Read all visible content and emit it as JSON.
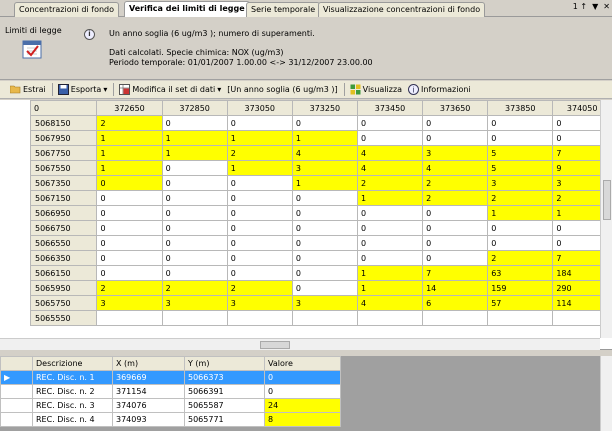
{
  "tabs": [
    {
      "label": "Concentrazioni di fondo"
    },
    {
      "label": "Verifica dei limiti di legge"
    },
    {
      "label": "Serie temporale"
    },
    {
      "label": "Visualizzazione concentrazioni  di  fondo"
    }
  ],
  "tab_controls": {
    "pin": "1 ↑",
    "dropdown": "▼",
    "close": "✕"
  },
  "header": {
    "limits_label": "Limiti di legge",
    "line1": "Un anno soglia (6 ug/m3 ); numero di superamenti.",
    "line2": "Dati calcolati. Specie chimica: NOX (ug/m3)",
    "line3": "Periodo temporale: 01/01/2007 1.00.00 <-> 31/12/2007 23.00.00"
  },
  "toolbar": {
    "estrai": "Estrai",
    "esporta": "Esporta",
    "modifica": "Modifica il set di dati",
    "dataset": "[Un anno soglia (6 ug/m3 )]",
    "visualizza": "Visualizza",
    "informazioni": "Informazioni"
  },
  "grid": {
    "corner": "0",
    "columns": [
      "372650",
      "372850",
      "373050",
      "373250",
      "373450",
      "373650",
      "373850",
      "374050"
    ],
    "rows": [
      {
        "y": "5068150",
        "cells": [
          "2",
          "0",
          "0",
          "0",
          "0",
          "0",
          "0",
          "0"
        ],
        "hl": [
          1,
          0,
          0,
          0,
          0,
          0,
          0,
          0
        ]
      },
      {
        "y": "5067950",
        "cells": [
          "1",
          "1",
          "1",
          "1",
          "0",
          "0",
          "0",
          "0"
        ],
        "hl": [
          1,
          1,
          1,
          1,
          0,
          0,
          0,
          0
        ]
      },
      {
        "y": "5067750",
        "cells": [
          "1",
          "1",
          "2",
          "4",
          "4",
          "3",
          "5",
          "7"
        ],
        "hl": [
          1,
          1,
          1,
          1,
          1,
          1,
          1,
          1
        ]
      },
      {
        "y": "5067550",
        "cells": [
          "1",
          "0",
          "1",
          "3",
          "4",
          "4",
          "5",
          "9"
        ],
        "hl": [
          1,
          0,
          1,
          1,
          1,
          1,
          1,
          1
        ]
      },
      {
        "y": "5067350",
        "cells": [
          "0",
          "0",
          "0",
          "1",
          "2",
          "2",
          "3",
          "3"
        ],
        "hl": [
          1,
          0,
          0,
          1,
          1,
          1,
          1,
          1
        ]
      },
      {
        "y": "5067150",
        "cells": [
          "0",
          "0",
          "0",
          "0",
          "1",
          "2",
          "2",
          "2"
        ],
        "hl": [
          0,
          0,
          0,
          0,
          1,
          1,
          1,
          1
        ]
      },
      {
        "y": "5066950",
        "cells": [
          "0",
          "0",
          "0",
          "0",
          "0",
          "0",
          "1",
          "1"
        ],
        "hl": [
          0,
          0,
          0,
          0,
          0,
          0,
          1,
          1
        ]
      },
      {
        "y": "5066750",
        "cells": [
          "0",
          "0",
          "0",
          "0",
          "0",
          "0",
          "0",
          "0"
        ],
        "hl": [
          0,
          0,
          0,
          0,
          0,
          0,
          0,
          0
        ]
      },
      {
        "y": "5066550",
        "cells": [
          "0",
          "0",
          "0",
          "0",
          "0",
          "0",
          "0",
          "0"
        ],
        "hl": [
          0,
          0,
          0,
          0,
          0,
          0,
          0,
          0
        ]
      },
      {
        "y": "5066350",
        "cells": [
          "0",
          "0",
          "0",
          "0",
          "0",
          "0",
          "2",
          "7"
        ],
        "hl": [
          0,
          0,
          0,
          0,
          0,
          0,
          1,
          1
        ]
      },
      {
        "y": "5066150",
        "cells": [
          "0",
          "0",
          "0",
          "0",
          "1",
          "7",
          "63",
          "184"
        ],
        "hl": [
          0,
          0,
          0,
          0,
          1,
          1,
          1,
          1
        ]
      },
      {
        "y": "5065950",
        "cells": [
          "2",
          "2",
          "2",
          "0",
          "1",
          "14",
          "159",
          "290"
        ],
        "hl": [
          1,
          1,
          1,
          0,
          1,
          1,
          1,
          1
        ]
      },
      {
        "y": "5065750",
        "cells": [
          "3",
          "3",
          "3",
          "3",
          "4",
          "6",
          "57",
          "114"
        ],
        "hl": [
          1,
          1,
          1,
          1,
          1,
          1,
          1,
          1
        ]
      },
      {
        "y": "5065550",
        "cells": [
          "",
          "",
          "",
          "",
          "",
          "",
          "",
          ""
        ],
        "hl": [
          0,
          0,
          0,
          0,
          0,
          0,
          0,
          0
        ]
      }
    ]
  },
  "receptors": {
    "headers": [
      "Descrizione",
      "X (m)",
      "Y (m)",
      "Valore"
    ],
    "rows": [
      {
        "desc": "REC. Disc. n. 1",
        "x": "369669",
        "y": "5066373",
        "val": "0",
        "hl": false
      },
      {
        "desc": "REC. Disc. n. 2",
        "x": "371154",
        "y": "5066391",
        "val": "0",
        "hl": false
      },
      {
        "desc": "REC. Disc. n. 3",
        "x": "374076",
        "y": "5065587",
        "val": "24",
        "hl": true
      },
      {
        "desc": "REC. Disc. n. 4",
        "x": "374093",
        "y": "5065771",
        "val": "8",
        "hl": true
      }
    ]
  },
  "colors": {
    "highlight": "#ffff00",
    "selection": "#3399ff"
  }
}
